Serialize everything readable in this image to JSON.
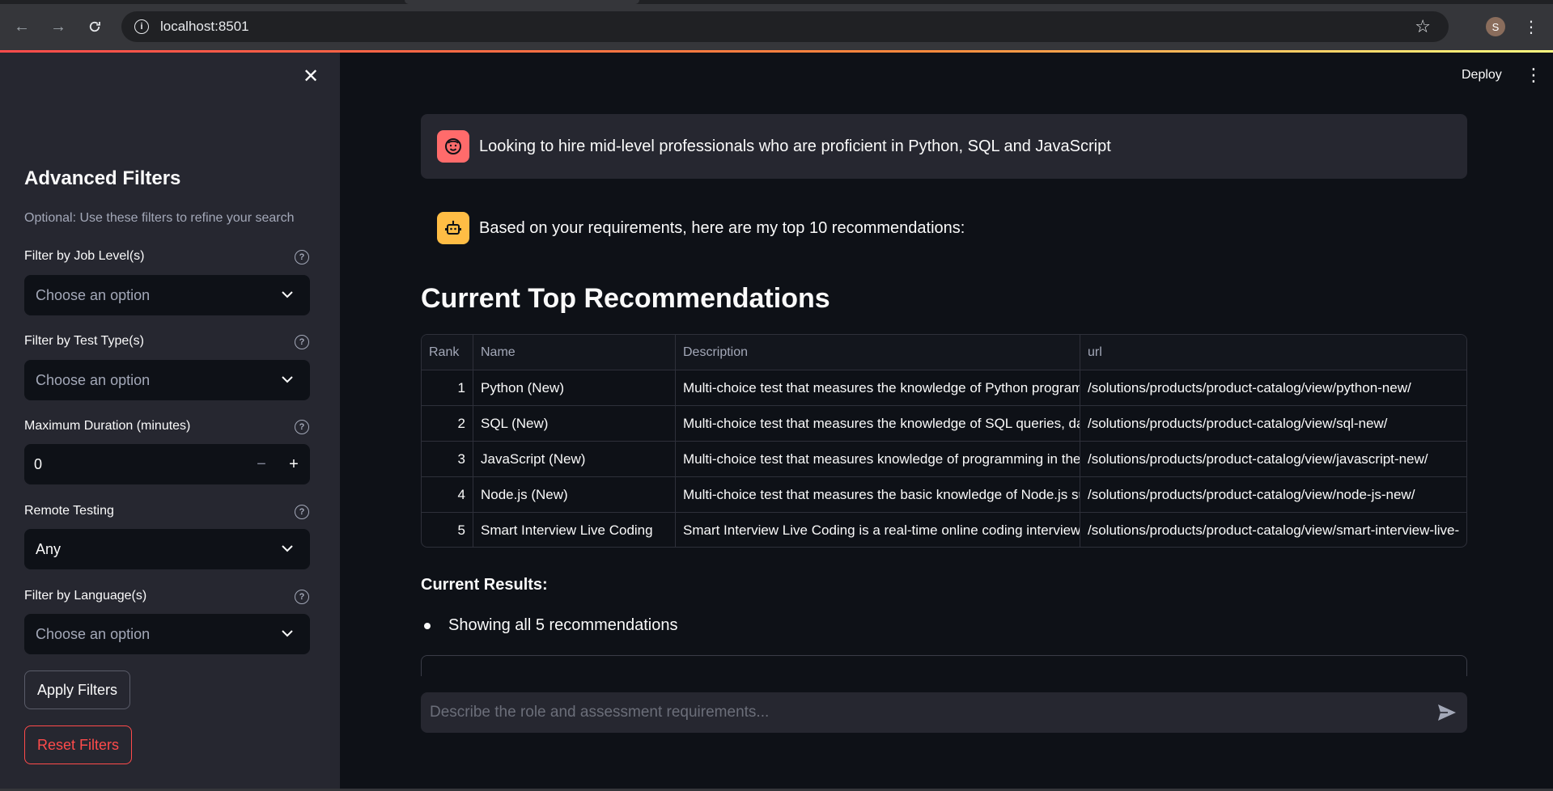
{
  "browser": {
    "url": "localhost:8501",
    "profile_initial": "S"
  },
  "sidebar": {
    "title": "Advanced Filters",
    "caption": "Optional: Use these filters to refine your search",
    "job_level": {
      "label": "Filter by Job Level(s)",
      "placeholder": "Choose an option"
    },
    "test_type": {
      "label": "Filter by Test Type(s)",
      "placeholder": "Choose an option"
    },
    "duration": {
      "label": "Maximum Duration (minutes)",
      "value": "0"
    },
    "remote": {
      "label": "Remote Testing",
      "value": "Any"
    },
    "language": {
      "label": "Filter by Language(s)",
      "placeholder": "Choose an option"
    },
    "apply_label": "Apply Filters",
    "reset_label": "Reset Filters"
  },
  "header": {
    "deploy_label": "Deploy"
  },
  "chat": {
    "user_message": "Looking to hire mid-level professionals who are proficient in Python, SQL and JavaScript",
    "assistant_message": "Based on your requirements, here are my top 10 recommendations:",
    "input_placeholder": "Describe the role and assessment requirements..."
  },
  "recommendations": {
    "heading": "Current Top Recommendations",
    "columns": [
      "Rank",
      "Name",
      "Description",
      "url"
    ],
    "rows": [
      {
        "rank": "1",
        "name": "Python (New)",
        "description": "Multi-choice test that measures the knowledge of Python programm",
        "url": "/solutions/products/product-catalog/view/python-new/"
      },
      {
        "rank": "2",
        "name": "SQL (New)",
        "description": "Multi-choice test that measures the knowledge of SQL queries, data",
        "url": "/solutions/products/product-catalog/view/sql-new/"
      },
      {
        "rank": "3",
        "name": "JavaScript (New)",
        "description": "Multi-choice test that measures knowledge of programming in the J",
        "url": "/solutions/products/product-catalog/view/javascript-new/"
      },
      {
        "rank": "4",
        "name": "Node.js (New)",
        "description": "Multi-choice test that measures the basic knowledge of Node.js such",
        "url": "/solutions/products/product-catalog/view/node-js-new/"
      },
      {
        "rank": "5",
        "name": "Smart Interview Live Coding",
        "description": "Smart Interview Live Coding is a real-time online coding interview, w",
        "url": "/solutions/products/product-catalog/view/smart-interview-live-"
      }
    ]
  },
  "results": {
    "title": "Current Results:",
    "items": [
      "Showing all 5 recommendations"
    ]
  }
}
